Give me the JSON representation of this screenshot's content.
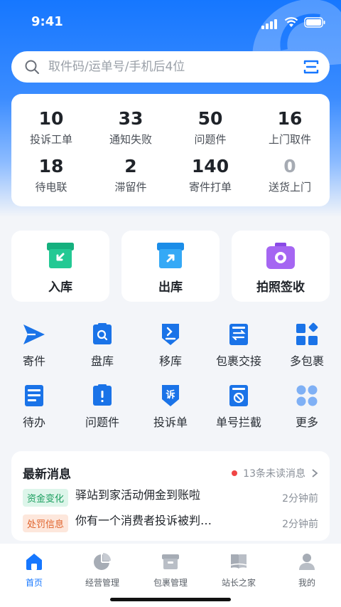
{
  "status_bar": {
    "time": "9:41"
  },
  "search": {
    "placeholder": "取件码/运单号/手机后4位"
  },
  "stats": [
    {
      "value": "10",
      "label": "投诉工单"
    },
    {
      "value": "33",
      "label": "通知失败"
    },
    {
      "value": "50",
      "label": "问题件"
    },
    {
      "value": "16",
      "label": "上门取件"
    },
    {
      "value": "18",
      "label": "待电联"
    },
    {
      "value": "2",
      "label": "滞留件"
    },
    {
      "value": "140",
      "label": "寄件打单"
    },
    {
      "value": "0",
      "label": "送货上门"
    }
  ],
  "big_actions": [
    {
      "label": "入库",
      "icon": "box-in-icon",
      "color": "#1fbf8a"
    },
    {
      "label": "出库",
      "icon": "box-out-icon",
      "color": "#2a9cf5"
    },
    {
      "label": "拍照签收",
      "icon": "camera-icon",
      "color": "#9d5cf0"
    }
  ],
  "grid": [
    {
      "label": "寄件",
      "icon": "send-icon"
    },
    {
      "label": "盘库",
      "icon": "inventory-icon"
    },
    {
      "label": "移库",
      "icon": "move-icon"
    },
    {
      "label": "包裹交接",
      "icon": "handover-icon"
    },
    {
      "label": "多包裹",
      "icon": "multi-package-icon"
    },
    {
      "label": "待办",
      "icon": "todo-icon"
    },
    {
      "label": "问题件",
      "icon": "problem-icon"
    },
    {
      "label": "投诉单",
      "icon": "complaint-icon"
    },
    {
      "label": "单号拦截",
      "icon": "intercept-icon"
    },
    {
      "label": "更多",
      "icon": "more-icon"
    }
  ],
  "news": {
    "title": "最新消息",
    "unread": "13条未读消息",
    "items": [
      {
        "tag": "资金变化",
        "text": "驿站到家活动佣金到账啦",
        "time": "2分钟前"
      },
      {
        "tag": "处罚信息",
        "text": "你有一个消费者投诉被判…",
        "time": "2分钟前"
      }
    ]
  },
  "tabs": [
    {
      "label": "首页",
      "icon": "home-icon",
      "active": true
    },
    {
      "label": "经营管理",
      "icon": "chart-icon"
    },
    {
      "label": "包裹管理",
      "icon": "package-icon"
    },
    {
      "label": "站长之家",
      "icon": "book-icon"
    },
    {
      "label": "我的",
      "icon": "user-icon"
    }
  ],
  "colors": {
    "primary": "#1677ff",
    "accent_icon": "#1a73e8"
  }
}
